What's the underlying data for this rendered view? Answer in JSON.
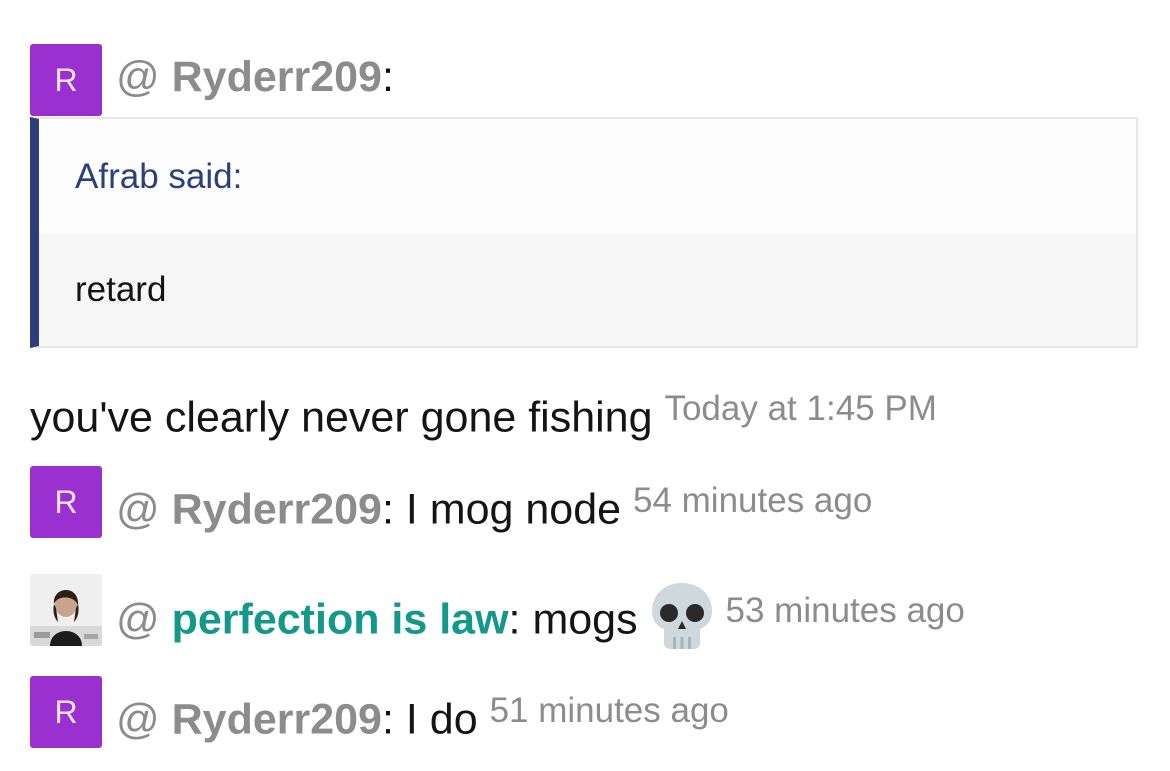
{
  "posts": [
    {
      "avatar_letter": "R",
      "at": "@",
      "username": "Ryderr209",
      "separator": ":",
      "message": "",
      "timestamp": ""
    },
    {
      "avatar_letter": "R",
      "at": "@",
      "username": "Ryderr209",
      "separator": ":",
      "message": " I mog node",
      "timestamp": "54 minutes ago"
    },
    {
      "avatar_letter": "",
      "at": "@",
      "username": "perfection is law",
      "separator": ":",
      "message": " mogs",
      "emoji": "skull",
      "timestamp": "53 minutes ago"
    },
    {
      "avatar_letter": "R",
      "at": "@",
      "username": "Ryderr209",
      "separator": ":",
      "message": " I do",
      "timestamp": "51 minutes ago"
    }
  ],
  "quote": {
    "author_line": "Afrab said:",
    "text": "retard"
  },
  "reply": {
    "text": "you've clearly never gone fishing",
    "timestamp": "Today at 1:45 PM"
  },
  "colors": {
    "avatar_purple": "#9b30d1",
    "username_gray": "#8c8c8c",
    "username_green": "#12998a",
    "quote_accent": "#2b3f7c"
  }
}
